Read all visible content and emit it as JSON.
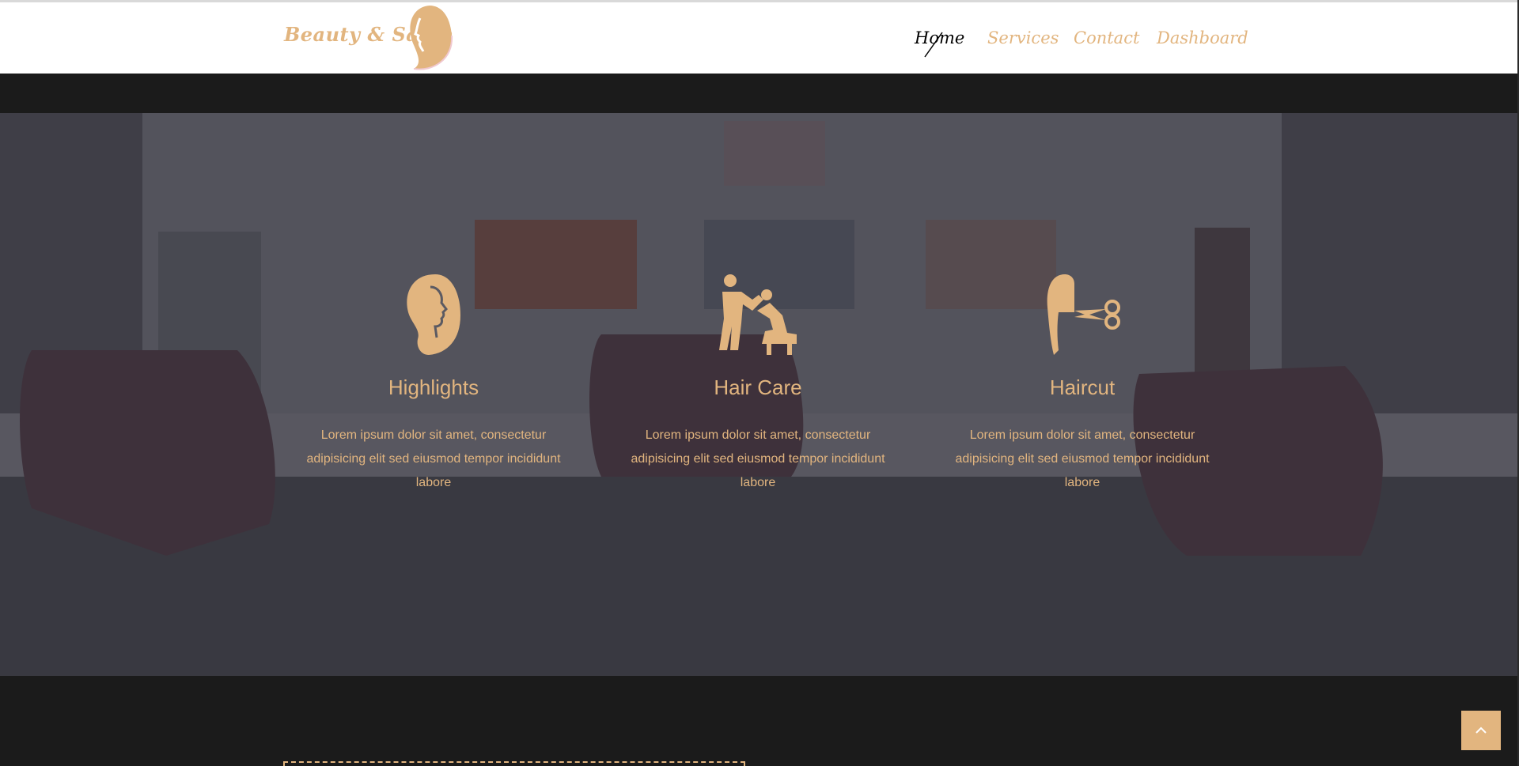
{
  "brand": {
    "logo_text": "Beauty & Salon"
  },
  "nav": {
    "items": [
      {
        "label": "Home",
        "active": true
      },
      {
        "label": "Services",
        "active": false
      },
      {
        "label": "Contact",
        "active": false
      },
      {
        "label": "Dashboard",
        "active": false
      }
    ]
  },
  "features": [
    {
      "icon": "woman-profile-icon",
      "title": "Highlights",
      "text": "Lorem ipsum dolor sit amet, consectetur adipisicing elit sed eiusmod tempor incididunt labore"
    },
    {
      "icon": "hair-washing-icon",
      "title": "Hair Care",
      "text": "Lorem ipsum dolor sit amet, consectetur adipisicing elit sed eiusmod tempor incididunt labore"
    },
    {
      "icon": "haircut-scissors-icon",
      "title": "Haircut",
      "text": "Lorem ipsum dolor sit amet, consectetur adipisicing elit sed eiusmod tempor incididunt labore"
    }
  ],
  "back_to_top": {
    "icon": "chevron-up-icon"
  },
  "colors": {
    "accent": "#e2b57f",
    "dark": "#1b1b1b",
    "nav_bg": "#ffffff",
    "active_nav": "#000000"
  }
}
